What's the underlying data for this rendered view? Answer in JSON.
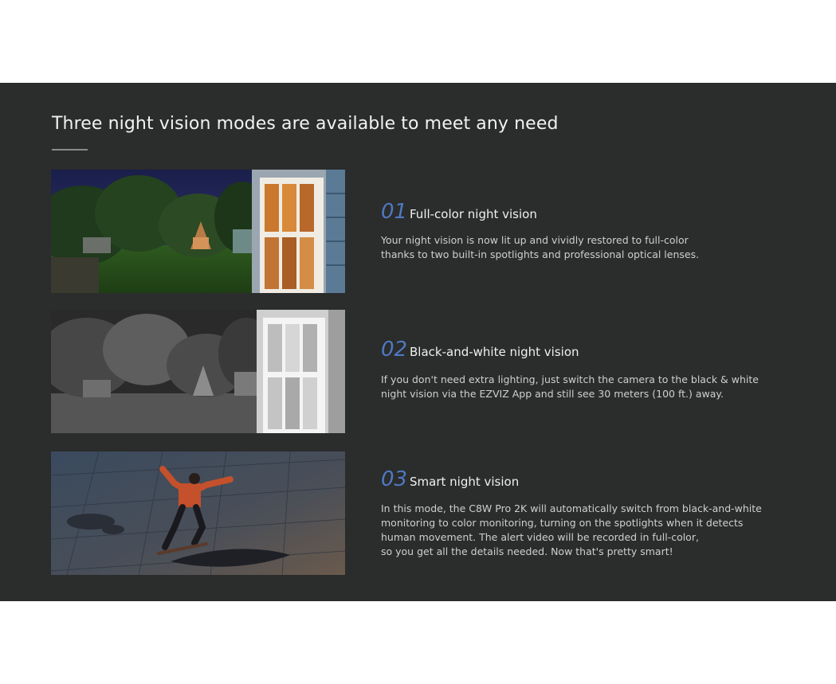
{
  "section": {
    "heading": "Three night vision modes are available to meet any need"
  },
  "features": [
    {
      "number": "01",
      "title": "Full-color night vision",
      "image_icon": "full-color-night-scene-image",
      "lines": [
        "Your night vision is now lit up and vividly restored to full-color",
        "thanks to two built-in spotlights and professional optical lenses."
      ]
    },
    {
      "number": "02",
      "title": "Black-and-white night vision",
      "image_icon": "black-and-white-night-scene-image",
      "lines": [
        "If you don't need extra lighting, just switch the camera to the black & white",
        "night vision via the EZVIZ App and still see 30 meters (100 ft.) away."
      ]
    },
    {
      "number": "03",
      "title": "Smart night vision",
      "image_icon": "skateboarder-night-image",
      "lines": [
        "In this mode, the C8W Pro 2K will automatically switch from black-and-white",
        "monitoring to color monitoring, turning on the spotlights when it detects",
        "human movement. The alert video will be recorded in full-color,",
        "so you get all the details needed. Now that's pretty smart!"
      ]
    }
  ],
  "colors": {
    "background_band": "#2b2c2c",
    "accent_number": "#4e79c2",
    "heading_text": "#f2f2f2",
    "body_text": "#cfcfcf"
  }
}
